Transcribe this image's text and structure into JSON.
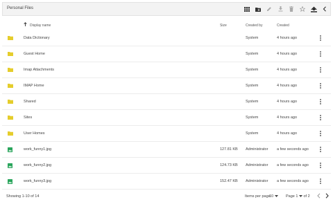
{
  "toolbar": {
    "title": "Personal Files",
    "icons": [
      "grid-icon",
      "new-folder-icon",
      "edit-icon",
      "download-icon",
      "delete-icon",
      "favorite-icon",
      "upload-icon",
      "chevron-left-icon"
    ]
  },
  "header": {
    "sort_indicator": "arrow-up-icon",
    "display_name": "Display name",
    "size": "Size",
    "created_by": "Created by",
    "created": "Created"
  },
  "rows": [
    {
      "type": "folder",
      "name": "Data Dictionary",
      "size": "",
      "created_by": "System",
      "created": "4 hours ago"
    },
    {
      "type": "folder",
      "name": "Guest Home",
      "size": "",
      "created_by": "System",
      "created": "4 hours ago"
    },
    {
      "type": "folder",
      "name": "Imap Attachments",
      "size": "",
      "created_by": "System",
      "created": "4 hours ago"
    },
    {
      "type": "folder",
      "name": "IMAP Home",
      "size": "",
      "created_by": "System",
      "created": "4 hours ago"
    },
    {
      "type": "folder",
      "name": "Shared",
      "size": "",
      "created_by": "System",
      "created": "4 hours ago"
    },
    {
      "type": "folder",
      "name": "Sites",
      "size": "",
      "created_by": "System",
      "created": "4 hours ago"
    },
    {
      "type": "folder",
      "name": "User Homes",
      "size": "",
      "created_by": "System",
      "created": "4 hours ago"
    },
    {
      "type": "image",
      "name": "work_funny1.jpg",
      "size": "127.81 KB",
      "created_by": "Administrator",
      "created": "a few seconds ago"
    },
    {
      "type": "image",
      "name": "work_funny2.jpg",
      "size": "124.73 KB",
      "created_by": "Administrator",
      "created": "a few seconds ago"
    },
    {
      "type": "image",
      "name": "work_funny3.jpg",
      "size": "152.47 KB",
      "created_by": "Administrator",
      "created": "a few seconds ago"
    }
  ],
  "footer": {
    "showing": "Showing 1-10 of 14",
    "items_per_page_label": "Items per page",
    "items_per_page_value": "10",
    "page_label": "Page 1",
    "page_of": "of 2"
  },
  "colors": {
    "folder": "#e5cd2c",
    "image": "#2aa55c",
    "toolbar_bg": "#f3f3f3",
    "icon": "#444444"
  }
}
